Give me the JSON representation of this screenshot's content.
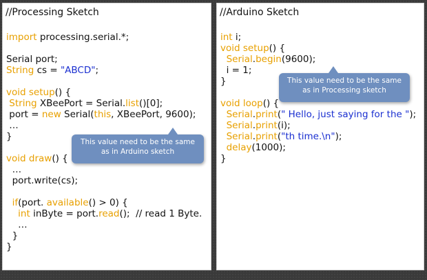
{
  "processing": {
    "title": "//Processing Sketch",
    "lines": [
      [
        [
          "import",
          "kw"
        ],
        [
          " processing.serial.*;",
          ""
        ]
      ],
      [],
      [
        [
          "Serial port;",
          ""
        ]
      ],
      [
        [
          "String",
          "kw"
        ],
        [
          " cs = ",
          ""
        ],
        [
          "\"ABCD\"",
          "str"
        ],
        [
          ";",
          ""
        ]
      ],
      [],
      [
        [
          "void",
          "kw"
        ],
        [
          " ",
          ""
        ],
        [
          "setup",
          "fn"
        ],
        [
          "() {",
          ""
        ]
      ],
      [
        [
          " ",
          ""
        ],
        [
          "String",
          "kw"
        ],
        [
          " XBeePort = Serial.",
          ""
        ],
        [
          "list",
          "fn"
        ],
        [
          "()[0];",
          ""
        ]
      ],
      [
        [
          " port = ",
          ""
        ],
        [
          "new",
          "kw"
        ],
        [
          " Serial(",
          ""
        ],
        [
          "this",
          "kw"
        ],
        [
          ", XBeePort, 9600);",
          ""
        ]
      ],
      [
        [
          " …",
          ""
        ]
      ],
      [
        [
          "}",
          ""
        ]
      ],
      [],
      [
        [
          "void",
          "kw"
        ],
        [
          " ",
          ""
        ],
        [
          "draw",
          "fn"
        ],
        [
          "() {",
          ""
        ]
      ],
      [
        [
          "  …",
          ""
        ]
      ],
      [
        [
          "  port.write(cs);",
          ""
        ]
      ],
      [],
      [
        [
          "  ",
          ""
        ],
        [
          "if",
          "kw"
        ],
        [
          "(port. ",
          ""
        ],
        [
          "available",
          "fn"
        ],
        [
          "() > 0) {",
          ""
        ]
      ],
      [
        [
          "    ",
          ""
        ],
        [
          "int",
          "kw"
        ],
        [
          " inByte = port.",
          ""
        ],
        [
          "read",
          "fn"
        ],
        [
          "();  // read 1 Byte.",
          ""
        ]
      ],
      [
        [
          "    …",
          ""
        ]
      ],
      [
        [
          "  }",
          ""
        ]
      ],
      [
        [
          "}",
          ""
        ]
      ]
    ],
    "callout": "This value need to be the same as in Arduino sketch"
  },
  "arduino": {
    "title": "//Arduino Sketch",
    "lines": [
      [
        [
          "int",
          "kw"
        ],
        [
          " i;",
          ""
        ]
      ],
      [
        [
          "void",
          "kw"
        ],
        [
          " ",
          ""
        ],
        [
          "setup",
          "fn"
        ],
        [
          "() {",
          ""
        ]
      ],
      [
        [
          "  ",
          ""
        ],
        [
          "Serial",
          "kw"
        ],
        [
          ".",
          ""
        ],
        [
          "begin",
          "fn"
        ],
        [
          "(9600);",
          ""
        ]
      ],
      [
        [
          "  i = 1;",
          ""
        ]
      ],
      [
        [
          "}",
          ""
        ]
      ],
      [],
      [
        [
          "void",
          "kw"
        ],
        [
          " ",
          ""
        ],
        [
          "loop",
          "fn"
        ],
        [
          "() {",
          ""
        ]
      ],
      [
        [
          "  ",
          ""
        ],
        [
          "Serial",
          "kw"
        ],
        [
          ".",
          ""
        ],
        [
          "print",
          "fn"
        ],
        [
          "(",
          ""
        ],
        [
          "\" Hello, just saying for the \"",
          "str"
        ],
        [
          ");",
          ""
        ]
      ],
      [
        [
          "  ",
          ""
        ],
        [
          "Serial",
          "kw"
        ],
        [
          ".",
          ""
        ],
        [
          "print",
          "fn"
        ],
        [
          "(i);",
          ""
        ]
      ],
      [
        [
          "  ",
          ""
        ],
        [
          "Serial",
          "kw"
        ],
        [
          ".",
          ""
        ],
        [
          "print",
          "fn"
        ],
        [
          "(",
          ""
        ],
        [
          "\"th time.\\n\"",
          "str"
        ],
        [
          ");",
          ""
        ]
      ],
      [
        [
          "  ",
          ""
        ],
        [
          "delay",
          "fn"
        ],
        [
          "(1000);",
          ""
        ]
      ],
      [
        [
          "}",
          ""
        ]
      ]
    ],
    "callout": "This value need to be the same as in Processing sketch"
  }
}
